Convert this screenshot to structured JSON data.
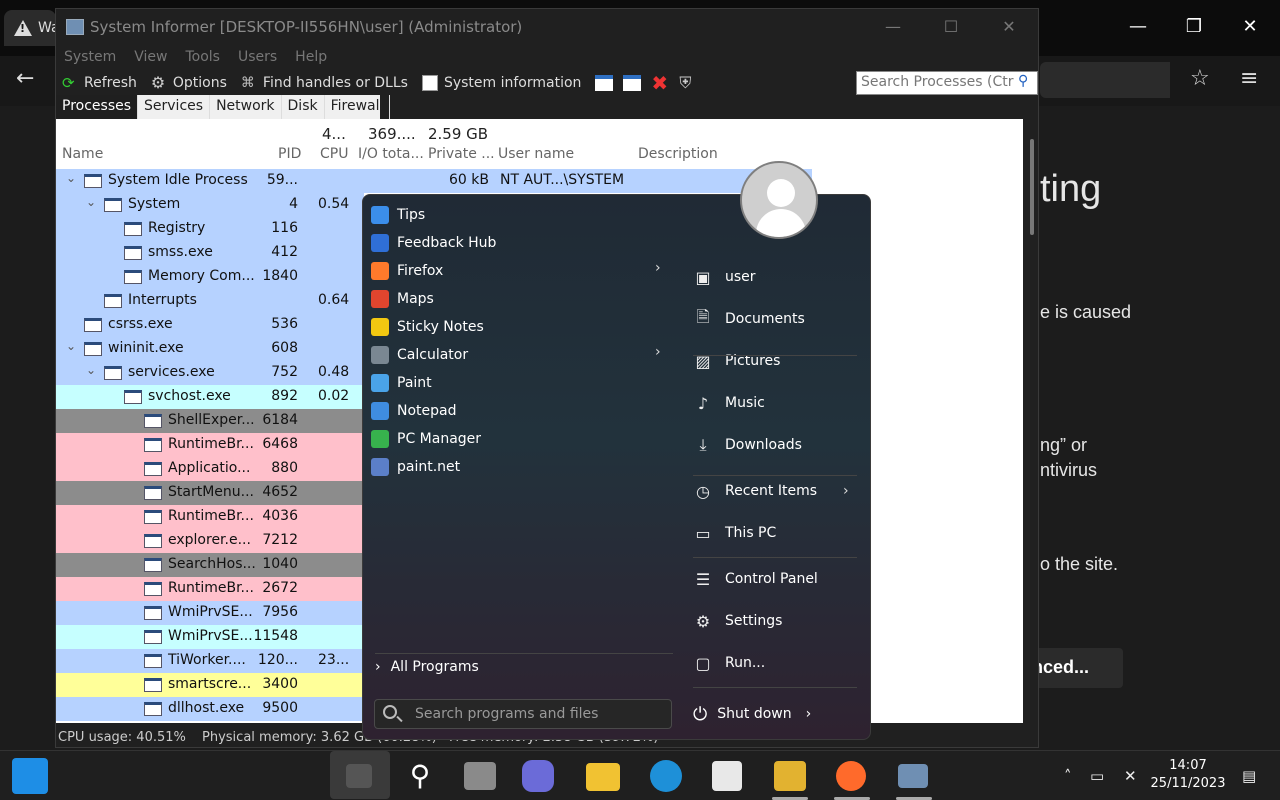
{
  "background": {
    "tab_label": "Wa",
    "text_lines": [
      "ting",
      "e is caused",
      "ng” or",
      "ntivirus",
      "o the site."
    ],
    "button_label": "nced..."
  },
  "window": {
    "title": "System Informer [DESKTOP-II556HN\\user] (Administrator)",
    "controls": {
      "minimize": "—",
      "maximize": "☐",
      "close": "✕"
    }
  },
  "menu": [
    "System",
    "View",
    "Tools",
    "Users",
    "Help"
  ],
  "toolbar": {
    "refresh": "Refresh",
    "options": "Options",
    "find_handles": "Find handles or DLLs",
    "system_information": "System information",
    "search_placeholder": "Search Processes (Ctr"
  },
  "tabs": [
    "Processes",
    "Services",
    "Network",
    "Disk",
    "Firewall"
  ],
  "columns": {
    "name": "Name",
    "pid": "PID",
    "cpu": "CPU",
    "io": "I/O tota...",
    "private": "Private ...",
    "user": "User name",
    "description": "Description",
    "cpu_total": "4...",
    "io_total": "369....",
    "private_total": "2.59 GB"
  },
  "processes": [
    {
      "name": "System Idle Process",
      "pid": "59...",
      "cpu": "",
      "private": "60 kB",
      "user": "NT AUT...\\SYSTEM",
      "depth": 0,
      "toggle": "⌄",
      "color": "#b6d2ff"
    },
    {
      "name": "System",
      "pid": "4",
      "cpu": "0.54",
      "depth": 1,
      "toggle": "⌄",
      "color": "#b6d2ff"
    },
    {
      "name": "Registry",
      "pid": "116",
      "cpu": "",
      "depth": 2,
      "toggle": "",
      "color": "#b6d2ff"
    },
    {
      "name": "smss.exe",
      "pid": "412",
      "cpu": "",
      "depth": 2,
      "toggle": "",
      "color": "#b6d2ff"
    },
    {
      "name": "Memory Com...",
      "pid": "1840",
      "cpu": "",
      "depth": 2,
      "toggle": "",
      "color": "#b6d2ff"
    },
    {
      "name": "Interrupts",
      "pid": "",
      "cpu": "0.64",
      "depth": 1,
      "toggle": "",
      "color": "#b6d2ff"
    },
    {
      "name": "csrss.exe",
      "pid": "536",
      "cpu": "",
      "depth": 0,
      "toggle": "",
      "color": "#b6d2ff"
    },
    {
      "name": "wininit.exe",
      "pid": "608",
      "cpu": "",
      "depth": 0,
      "toggle": "⌄",
      "color": "#b6d2ff"
    },
    {
      "name": "services.exe",
      "pid": "752",
      "cpu": "0.48",
      "depth": 1,
      "toggle": "⌄",
      "color": "#b6d2ff"
    },
    {
      "name": "svchost.exe",
      "pid": "892",
      "cpu": "0.02",
      "depth": 2,
      "toggle": "",
      "color": "#c6ffff"
    },
    {
      "name": "ShellExper...",
      "pid": "6184",
      "cpu": "",
      "depth": 3,
      "toggle": "",
      "color": "#8c8c8c"
    },
    {
      "name": "RuntimeBr...",
      "pid": "6468",
      "cpu": "",
      "depth": 3,
      "toggle": "",
      "color": "#ffc0cb"
    },
    {
      "name": "Applicatio...",
      "pid": "880",
      "cpu": "",
      "depth": 3,
      "toggle": "",
      "color": "#ffc0cb"
    },
    {
      "name": "StartMenu...",
      "pid": "4652",
      "cpu": "",
      "depth": 3,
      "toggle": "",
      "color": "#8c8c8c"
    },
    {
      "name": "RuntimeBr...",
      "pid": "4036",
      "cpu": "",
      "depth": 3,
      "toggle": "",
      "color": "#ffc0cb"
    },
    {
      "name": "explorer.e...",
      "pid": "7212",
      "cpu": "",
      "depth": 3,
      "toggle": "",
      "color": "#ffc0cb"
    },
    {
      "name": "SearchHos...",
      "pid": "1040",
      "cpu": "",
      "depth": 3,
      "toggle": "",
      "color": "#8c8c8c"
    },
    {
      "name": "RuntimeBr...",
      "pid": "2672",
      "cpu": "",
      "depth": 3,
      "toggle": "",
      "color": "#ffc0cb"
    },
    {
      "name": "WmiPrvSE...",
      "pid": "7956",
      "cpu": "",
      "depth": 3,
      "toggle": "",
      "color": "#b6d2ff"
    },
    {
      "name": "WmiPrvSE...",
      "pid": "11548",
      "cpu": "",
      "depth": 3,
      "toggle": "",
      "color": "#c6ffff"
    },
    {
      "name": "TiWorker....",
      "pid": "120...",
      "cpu": "23...",
      "depth": 3,
      "toggle": "",
      "color": "#b6d2ff"
    },
    {
      "name": "smartscre...",
      "pid": "3400",
      "cpu": "",
      "depth": 3,
      "toggle": "",
      "color": "#ffff99"
    },
    {
      "name": "dllhost.exe",
      "pid": "9500",
      "cpu": "",
      "depth": 3,
      "toggle": "",
      "color": "#b6d2ff"
    }
  ],
  "status": {
    "cpu": "CPU usage: 40.51%",
    "memory": "Physical memory: 3.62 GB (60.28%)",
    "free": "Free memory: 2.38 GB (39.72%)"
  },
  "start_menu": {
    "programs": [
      {
        "label": "Tips",
        "icon": "lightbulb-icon",
        "color": "#3b8eea",
        "submenu": false
      },
      {
        "label": "Feedback Hub",
        "icon": "feedback-icon",
        "color": "#2f6fd6",
        "submenu": false
      },
      {
        "label": "Firefox",
        "icon": "firefox-icon",
        "color": "#ff7a2b",
        "submenu": true
      },
      {
        "label": "Maps",
        "icon": "maps-icon",
        "color": "#e0452e",
        "submenu": false
      },
      {
        "label": "Sticky Notes",
        "icon": "sticky-notes-icon",
        "color": "#f2c811",
        "submenu": false
      },
      {
        "label": "Calculator",
        "icon": "calculator-icon",
        "color": "#7a8792",
        "submenu": true
      },
      {
        "label": "Paint",
        "icon": "paint-icon",
        "color": "#4aa3e8",
        "submenu": false
      },
      {
        "label": "Notepad",
        "icon": "notepad-icon",
        "color": "#3f8de0",
        "submenu": false
      },
      {
        "label": "PC Manager",
        "icon": "pc-manager-icon",
        "color": "#37b24d",
        "submenu": false
      },
      {
        "label": "paint.net",
        "icon": "paint-net-icon",
        "color": "#5b7fc8",
        "submenu": false
      }
    ],
    "all_programs": "All Programs",
    "search_placeholder": "Search programs and files",
    "places": [
      {
        "label": "user",
        "glyph": "▣",
        "icon": "user-folder-icon",
        "submenu": false
      },
      {
        "label": "Documents",
        "glyph": "🗎",
        "icon": "documents-icon",
        "submenu": false
      },
      {
        "label": "Pictures",
        "glyph": "▨",
        "icon": "pictures-icon",
        "submenu": false
      },
      {
        "label": "Music",
        "glyph": "♪",
        "icon": "music-icon",
        "submenu": false
      },
      {
        "label": "Downloads",
        "glyph": "⤓",
        "icon": "downloads-icon",
        "submenu": false
      },
      {
        "label": "Recent Items",
        "glyph": "◷",
        "icon": "clock-icon",
        "submenu": true
      },
      {
        "label": "This PC",
        "glyph": "▭",
        "icon": "this-pc-icon",
        "submenu": false
      },
      {
        "label": "Control Panel",
        "glyph": "☰",
        "icon": "control-panel-icon",
        "submenu": false
      },
      {
        "label": "Settings",
        "glyph": "⚙",
        "icon": "settings-icon",
        "submenu": false
      },
      {
        "label": "Run...",
        "glyph": "▢",
        "icon": "run-icon",
        "submenu": false
      }
    ],
    "shutdown": "Shut down"
  },
  "taskbar": {
    "time": "14:07",
    "date": "25/11/2023"
  }
}
